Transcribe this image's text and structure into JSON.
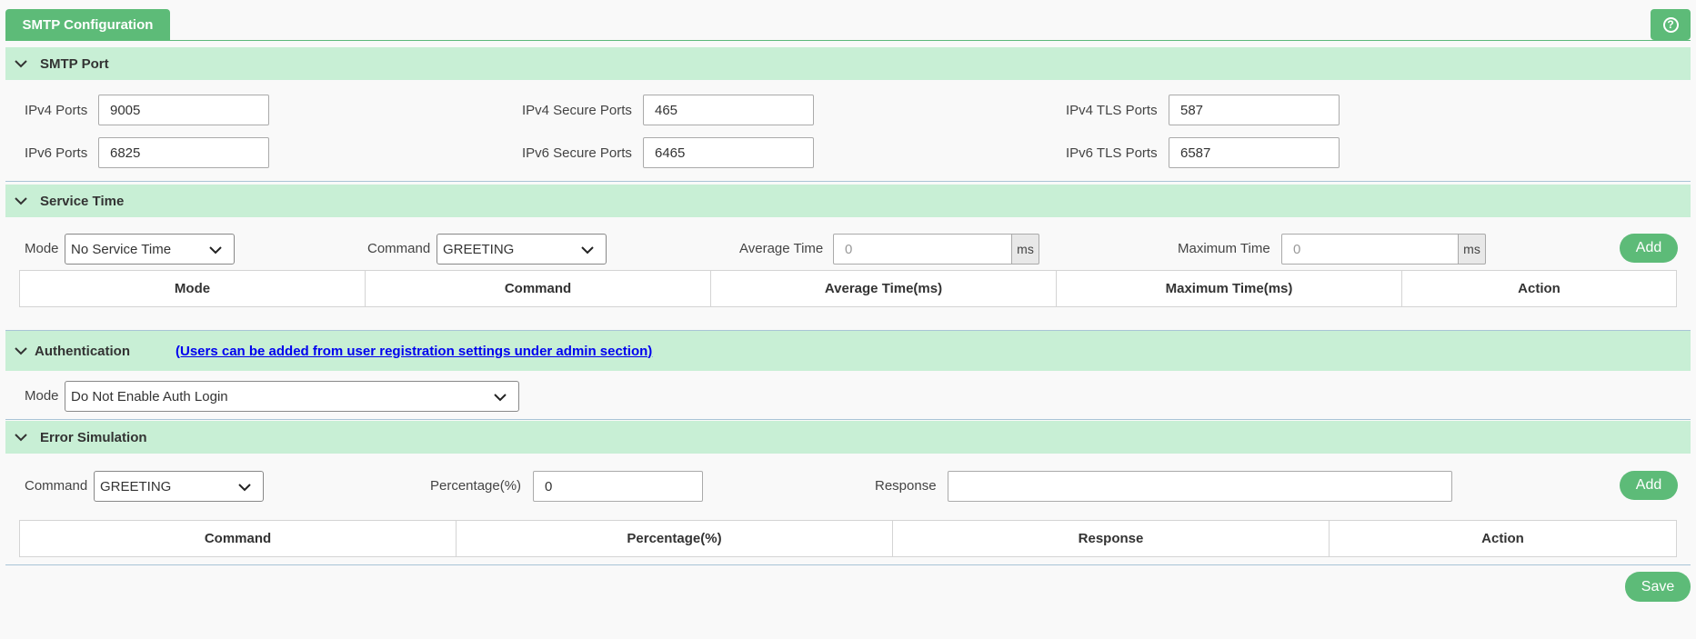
{
  "tabs": {
    "active": "SMTP Configuration",
    "help_glyph": "?"
  },
  "smtp_port": {
    "title": "SMTP Port",
    "ipv4_ports": {
      "label": "IPv4 Ports",
      "value": "9005"
    },
    "ipv4_secure_ports": {
      "label": "IPv4 Secure Ports",
      "value": "465"
    },
    "ipv4_tls_ports": {
      "label": "IPv4 TLS Ports",
      "value": "587"
    },
    "ipv6_ports": {
      "label": "IPv6 Ports",
      "value": "6825"
    },
    "ipv6_secure_ports": {
      "label": "IPv6 Secure Ports",
      "value": "6465"
    },
    "ipv6_tls_ports": {
      "label": "IPv6 TLS Ports",
      "value": "6587"
    }
  },
  "service_time": {
    "title": "Service Time",
    "mode": {
      "label": "Mode",
      "value": "No Service Time"
    },
    "command": {
      "label": "Command",
      "value": "GREETING"
    },
    "average_time": {
      "label": "Average Time",
      "placeholder": "0",
      "unit": "ms"
    },
    "maximum_time": {
      "label": "Maximum Time",
      "placeholder": "0",
      "unit": "ms"
    },
    "add_label": "Add",
    "columns": [
      "Mode",
      "Command",
      "Average Time(ms)",
      "Maximum Time(ms)",
      "Action"
    ]
  },
  "authentication": {
    "title": "Authentication",
    "note": "(Users can be added from user registration settings under admin section)",
    "mode": {
      "label": "Mode",
      "value": "Do Not Enable Auth Login"
    }
  },
  "error_simulation": {
    "title": "Error Simulation",
    "command": {
      "label": "Command",
      "value": "GREETING"
    },
    "percentage": {
      "label": "Percentage(%)",
      "value": "0"
    },
    "response": {
      "label": "Response",
      "value": ""
    },
    "add_label": "Add",
    "columns": [
      "Command",
      "Percentage(%)",
      "Response",
      "Action"
    ]
  },
  "save_label": "Save",
  "colors": {
    "accent": "#5dbb78",
    "section_bg": "#c8efd5",
    "link": "#0000ee"
  }
}
